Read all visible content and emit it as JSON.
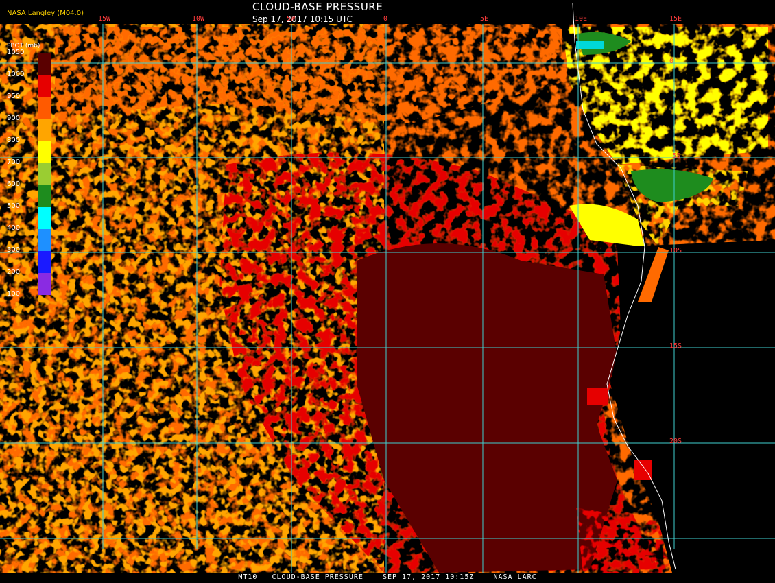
{
  "header": {
    "title": "CLOUD-BASE PRESSURE",
    "subtitle": "Sep 17, 2017 10:15 UTC",
    "agency": "NASA Langley (M04.0)"
  },
  "legend": {
    "title": "PBOT (mb)",
    "entries": [
      {
        "value": "1050",
        "color": "#5a0000"
      },
      {
        "value": "1000",
        "color": "#e60000"
      },
      {
        "value": "950",
        "color": "#ff5a00"
      },
      {
        "value": "900",
        "color": "#ffa500"
      },
      {
        "value": "800",
        "color": "#ffff00"
      },
      {
        "value": "700",
        "color": "#9acd32"
      },
      {
        "value": "600",
        "color": "#1e8c1e"
      },
      {
        "value": "500",
        "color": "#00ffff"
      },
      {
        "value": "400",
        "color": "#1e90ff"
      },
      {
        "value": "300",
        "color": "#1a1aff"
      },
      {
        "value": "200",
        "color": "#8a2be2"
      },
      {
        "value": "100",
        "color": "#8a2be2"
      }
    ]
  },
  "grid": {
    "lon_labels": [
      "15W",
      "10W",
      "5W",
      "0",
      "5E",
      "10E",
      "15E"
    ],
    "lat_labels": [
      "0",
      "5S",
      "10S",
      "15S",
      "20S"
    ]
  },
  "footer": "MT10   CLOUD-BASE PRESSURE    SEP 17, 2017 10:15Z    NASA LARC",
  "colors": {
    "dark_red": "#5a0000",
    "red": "#e60000",
    "orange_red": "#ff5a00",
    "orange": "#ffa500",
    "yellow": "#ffff00",
    "green": "#1e8c1e",
    "grid": "#3fd0d0",
    "background": "#000000"
  }
}
